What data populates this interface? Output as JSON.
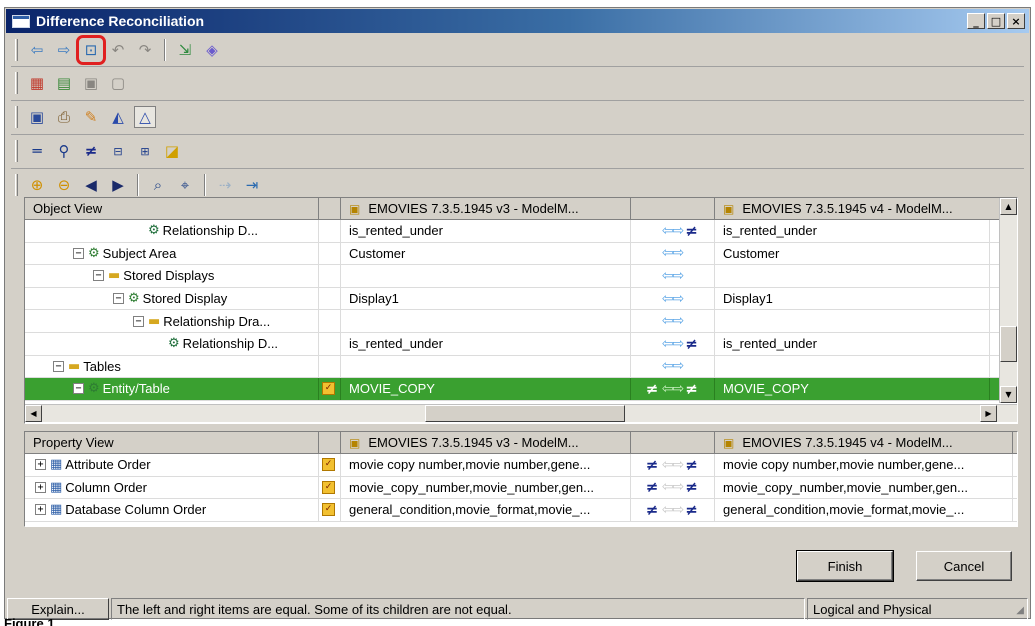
{
  "window": {
    "title": "Difference Reconciliation",
    "controls": [
      "minimize-icon",
      "maximize-icon",
      "close-icon"
    ]
  },
  "toolbars": [
    [
      "arrow-left-icon",
      "arrow-right-icon",
      "resolve-differences-icon",
      "undo-icon",
      "redo-icon",
      "separator",
      "export-icon",
      "eraser-icon"
    ],
    [
      "model-icon",
      "report-icon",
      "copy-icon",
      "paste-icon"
    ],
    [
      "save-icon",
      "print-icon",
      "pencil-icon",
      "triangle-up-icon",
      "triangle-outline-icon"
    ],
    [
      "equal-icon",
      "filter-icon",
      "not-equal-icon",
      "show-equal-icon",
      "show-diff-icon",
      "yellow-flag-icon"
    ],
    [
      "expand-all-icon",
      "collapse-all-icon",
      "prev-icon",
      "next-icon",
      "separator",
      "find-icon",
      "find-next-icon",
      "separator",
      "arrow-gray-icon",
      "export-arrow-icon"
    ]
  ],
  "object_view": {
    "header": {
      "name": "Object View",
      "left_model": "EMOVIES 7.3.5.1945 v3 - ModelM...",
      "right_model": "EMOVIES 7.3.5.1945 v4 - ModelM..."
    },
    "rows": [
      {
        "indent": 5,
        "toggle": "",
        "icon": "relationship-icon",
        "name": "Relationship D...",
        "flag": false,
        "left": "is_rented_under",
        "neq_left": false,
        "arrows": "blue",
        "neq_right": true,
        "right": "is_rented_under",
        "selected": false
      },
      {
        "indent": 2,
        "toggle": "⊟",
        "icon": "entity-icon",
        "name": "Subject Area",
        "flag": false,
        "left": "Customer",
        "neq_left": false,
        "arrows": "blue",
        "neq_right": false,
        "right": "Customer",
        "selected": false
      },
      {
        "indent": 3,
        "toggle": "⊟",
        "icon": "folder-icon",
        "name": "Stored Displays",
        "flag": false,
        "left": "",
        "neq_left": false,
        "arrows": "blue",
        "neq_right": false,
        "right": "",
        "selected": false
      },
      {
        "indent": 4,
        "toggle": "⊟",
        "icon": "entity-icon",
        "name": "Stored Display",
        "flag": false,
        "left": "Display1",
        "neq_left": false,
        "arrows": "blue",
        "neq_right": false,
        "right": "Display1",
        "selected": false
      },
      {
        "indent": 5,
        "toggle": "⊟",
        "icon": "folder-icon",
        "name": "Relationship Dra...",
        "flag": false,
        "left": "",
        "neq_left": false,
        "arrows": "blue",
        "neq_right": false,
        "right": "",
        "selected": false
      },
      {
        "indent": 6,
        "toggle": "",
        "icon": "relationship-icon",
        "name": "Relationship D...",
        "flag": false,
        "left": "is_rented_under",
        "neq_left": false,
        "arrows": "blue",
        "neq_right": true,
        "right": "is_rented_under",
        "selected": false
      },
      {
        "indent": 1,
        "toggle": "⊟",
        "icon": "folder-icon",
        "name": "Tables",
        "flag": false,
        "left": "",
        "neq_left": false,
        "arrows": "blue",
        "neq_right": false,
        "right": "",
        "selected": false
      },
      {
        "indent": 2,
        "toggle": "⊟",
        "icon": "entity-icon",
        "name": "Entity/Table",
        "flag": true,
        "left": "MOVIE_COPY",
        "neq_left": true,
        "arrows": "blue",
        "neq_right": true,
        "right": "MOVIE_COPY",
        "selected": true
      }
    ]
  },
  "property_view": {
    "header": {
      "name": "Property View",
      "left_model": "EMOVIES 7.3.5.1945 v3 - ModelM...",
      "right_model": "EMOVIES 7.3.5.1945 v4 - ModelM..."
    },
    "rows": [
      {
        "toggle": "⊞",
        "icon": "attribute-order-icon",
        "name": "Attribute Order",
        "flag": true,
        "left": "movie copy number,movie number,gene...",
        "neq_left": true,
        "arrows": "gray",
        "neq_right": true,
        "right": "movie copy number,movie number,gene..."
      },
      {
        "toggle": "⊞",
        "icon": "column-order-icon",
        "name": "Column Order",
        "flag": true,
        "left": "movie_copy_number,movie_number,gen...",
        "neq_left": true,
        "arrows": "gray",
        "neq_right": true,
        "right": "movie_copy_number,movie_number,gen..."
      },
      {
        "toggle": "⊞",
        "icon": "database-column-order-icon",
        "name": "Database Column Order",
        "flag": true,
        "left": "general_condition,movie_format,movie_...",
        "neq_left": true,
        "arrows": "gray",
        "neq_right": true,
        "right": "general_condition,movie_format,movie_..."
      }
    ]
  },
  "buttons": {
    "finish": "Finish",
    "cancel": "Cancel"
  },
  "status": {
    "explain_button": "Explain...",
    "message": "The left and right items are equal.  Some of its children are not equal.",
    "mode": "Logical and Physical"
  },
  "caption": "Figure 1"
}
